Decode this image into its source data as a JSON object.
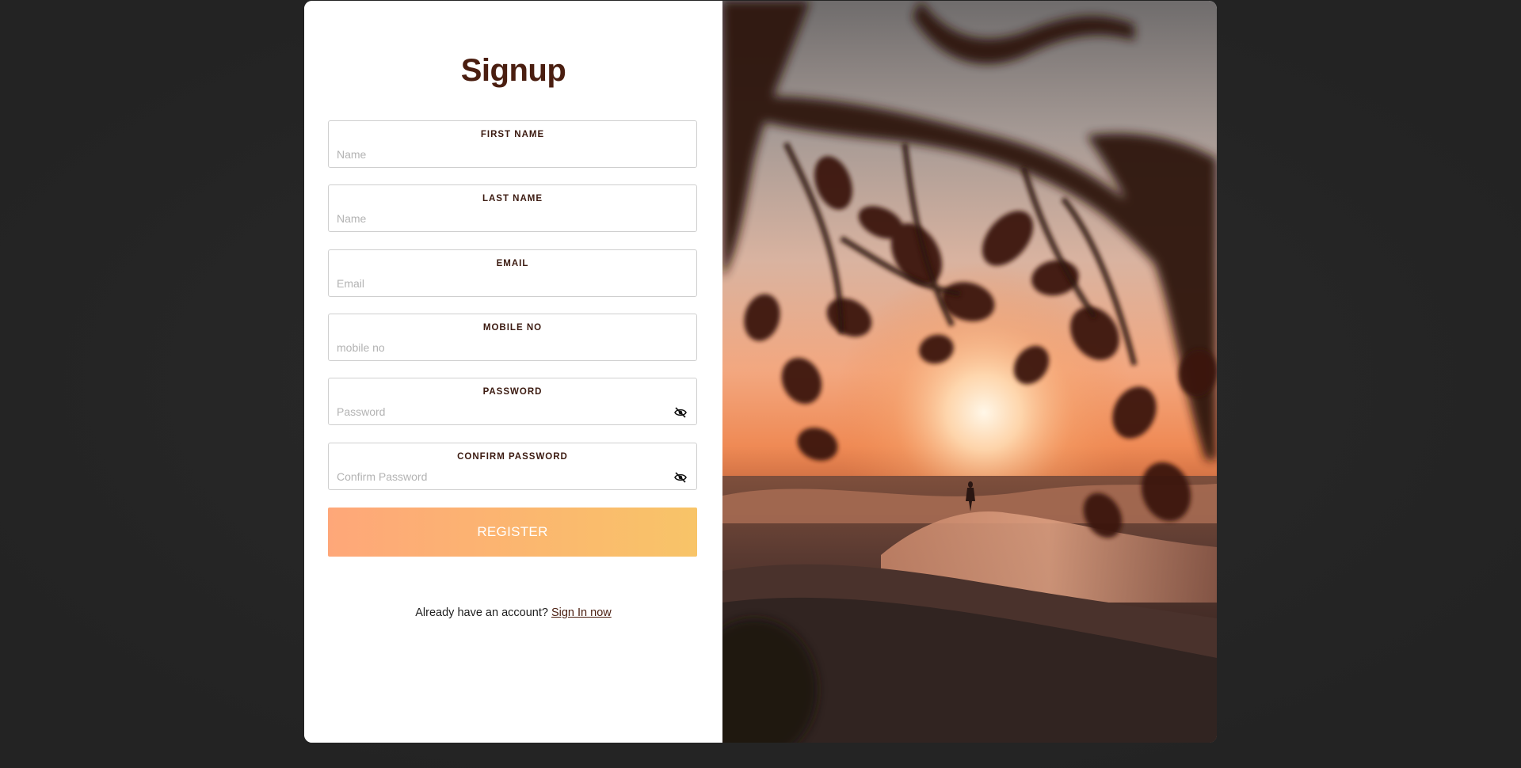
{
  "form": {
    "title": "Signup",
    "fields": [
      {
        "label": "FIRST NAME",
        "placeholder": "Name",
        "value": ""
      },
      {
        "label": "LAST NAME",
        "placeholder": "Name",
        "value": ""
      },
      {
        "label": "EMAIL",
        "placeholder": "Email",
        "value": ""
      },
      {
        "label": "MOBILE NO",
        "placeholder": "mobile no",
        "value": ""
      },
      {
        "label": "PASSWORD",
        "placeholder": "Password",
        "value": "",
        "icon": "eye-slash-icon"
      },
      {
        "label": "CONFIRM PASSWORD",
        "placeholder": "Confirm Password",
        "value": "",
        "icon": "eye-slash-icon"
      }
    ],
    "register_label": "REGISTER",
    "signin_prompt": "Already have an account?",
    "signin_link": "Sign In now"
  },
  "colors": {
    "background": "#262626",
    "title": "#4a1e10",
    "button_gradient_start": "#fea779",
    "button_gradient_end": "#f8c468"
  },
  "image": {
    "subject": "sunset-desert-photo"
  }
}
